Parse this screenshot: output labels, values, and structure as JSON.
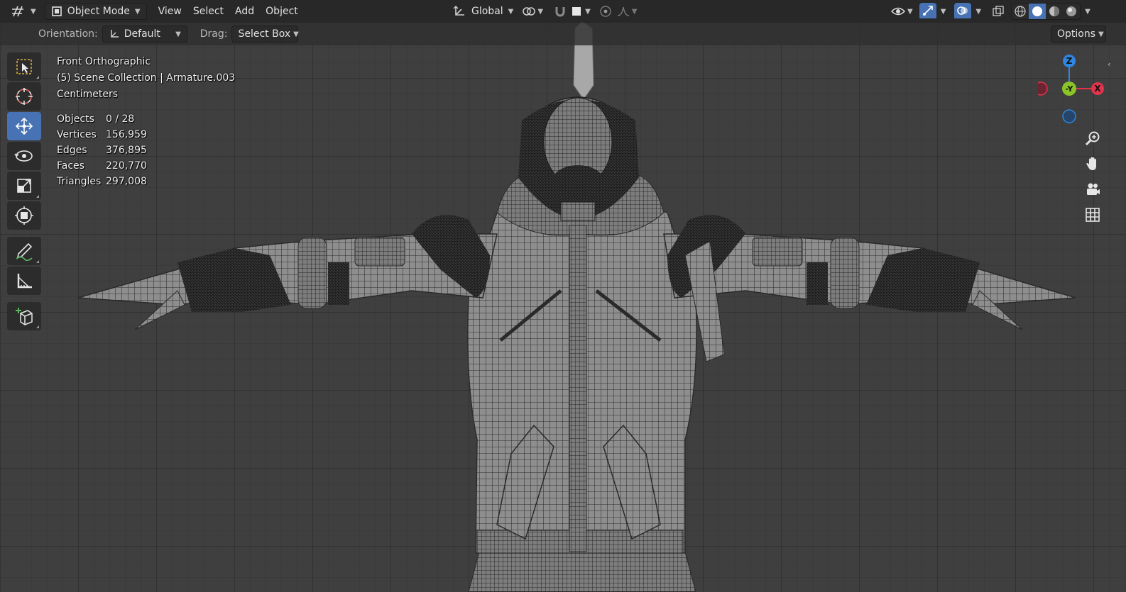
{
  "header": {
    "editor_type_icon": "viewport-editor-icon",
    "mode": "Object Mode",
    "menus": [
      "View",
      "Select",
      "Add",
      "Object"
    ],
    "transform_orientation": "Global"
  },
  "tool_settings": {
    "orientation_label": "Orientation:",
    "orientation_value": "Default",
    "drag_label": "Drag:",
    "drag_value": "Select Box",
    "options_label": "Options"
  },
  "overlay": {
    "view_name": "Front Orthographic",
    "collection": "(5) Scene Collection | Armature.003",
    "units": "Centimeters",
    "stats": [
      {
        "label": "Objects",
        "value": "0 / 28"
      },
      {
        "label": "Vertices",
        "value": "156,959"
      },
      {
        "label": "Edges",
        "value": "376,895"
      },
      {
        "label": "Faces",
        "value": "220,770"
      },
      {
        "label": "Triangles",
        "value": "297,008"
      }
    ]
  },
  "gizmo": {
    "z_label": "Z",
    "y_label": "-Y",
    "x_label": "X",
    "colors": {
      "x": "#e2334c",
      "y": "#8bc427",
      "z": "#2e86e0"
    }
  },
  "toolbar": {
    "tools": [
      "select-box-tool",
      "cursor-tool",
      "move-tool",
      "rotate-tool",
      "scale-tool",
      "transform-tool",
      "annotate-tool",
      "measure-tool",
      "add-cube-tool"
    ],
    "active_tool": "move-tool"
  },
  "shading": {
    "active_mode": "solid",
    "modes": [
      "wireframe",
      "solid",
      "material-preview",
      "rendered"
    ]
  },
  "theme": {
    "accent": "#4772b3",
    "viewport_bg": "#3f3f3f"
  }
}
